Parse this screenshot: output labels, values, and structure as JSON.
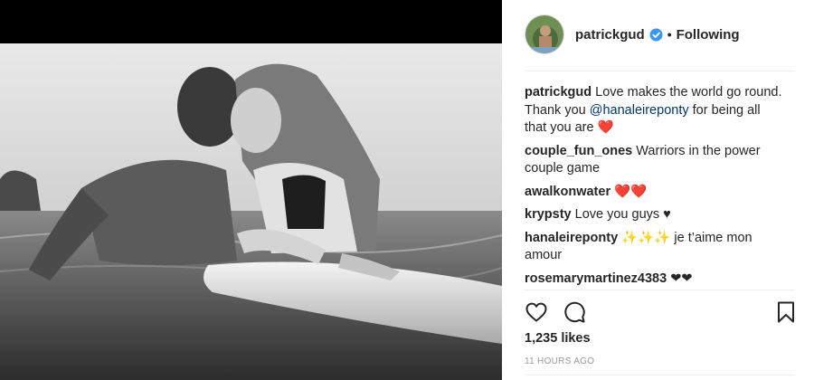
{
  "post": {
    "author": "patrickgud",
    "separator": "•",
    "follow_status": "Following",
    "verified": true
  },
  "comments": [
    {
      "user": "patrickgud",
      "text_before": "Love makes the world go round. Thank you ",
      "mention": "@hanaleireponty",
      "text_after": " for being all that you are ",
      "emoji": "❤️"
    },
    {
      "user": "couple_fun_ones",
      "text": "Warriors in the power couple game"
    },
    {
      "user": "awalkonwater",
      "emoji": "❤️❤️"
    },
    {
      "user": "krypsty",
      "text": "Love you guys ♥"
    },
    {
      "user": "hanaleireponty",
      "emoji": "✨✨✨",
      "text": "je t’aime mon amour"
    },
    {
      "user": "rosemarymartinez4383",
      "text": "❤❤"
    }
  ],
  "stats": {
    "likes": "1,235 likes",
    "time_ago": "11 HOURS AGO"
  },
  "icons": {
    "like": "heart-outline-icon",
    "comment": "speech-bubble-icon",
    "save": "bookmark-icon",
    "verified": "verified-badge-icon"
  },
  "colors": {
    "username": "#262626",
    "mention": "#003569",
    "timestamp": "#999999",
    "verified": "#3897f0",
    "heart": "#ed1c24"
  }
}
